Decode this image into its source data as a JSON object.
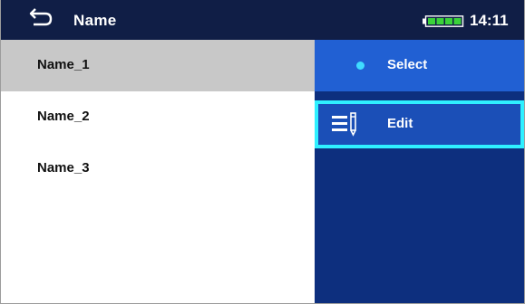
{
  "header": {
    "title": "Name",
    "time": "14:11",
    "back_icon": "back-arrow-icon",
    "battery_icon": "battery-full-icon",
    "battery_color": "#3ad23a"
  },
  "list": {
    "items": [
      {
        "label": "Name_1",
        "selected": true
      },
      {
        "label": "Name_2",
        "selected": false
      },
      {
        "label": "Name_3",
        "selected": false
      }
    ]
  },
  "menu": {
    "select_label": "Select",
    "edit_label": "Edit",
    "accent_color": "#2ff0ff",
    "panel_color": "#0d2f7e"
  }
}
